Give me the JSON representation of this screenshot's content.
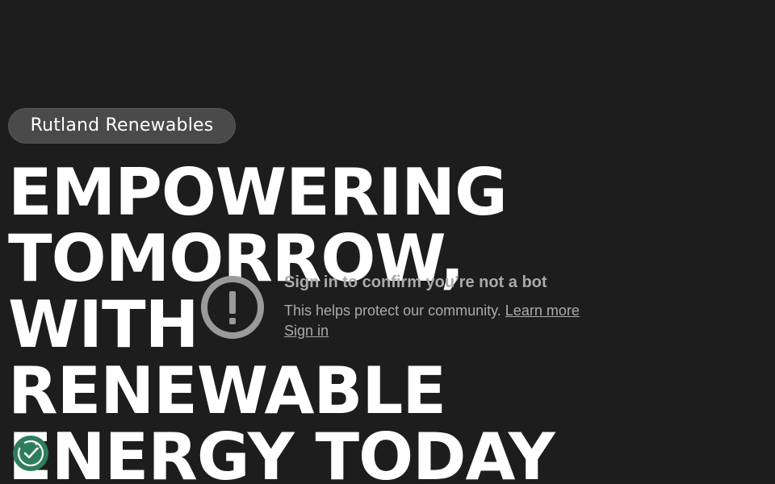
{
  "brand": {
    "name": "Rutland Renewables"
  },
  "hero": {
    "lines": [
      "EMPOWERING",
      "TOMORROW,",
      "WITH",
      "RENEWABLE",
      "ENERGY TODAY"
    ]
  },
  "bot_check": {
    "title": "Sign in to confirm you’re not a bot",
    "description": "This helps protect our community.",
    "learn_more_label": "Learn more",
    "sign_in_label": "Sign in",
    "icon": "exclamation-circle-icon"
  },
  "cookie_consent": {
    "icon": "cookie-consent-check-icon",
    "accent_color": "#2e7d5c"
  },
  "colors": {
    "background": "#1e1d1e",
    "text": "#ffffff",
    "muted_text": "#aaaaaa",
    "pill_background": "#4a4a4a"
  }
}
